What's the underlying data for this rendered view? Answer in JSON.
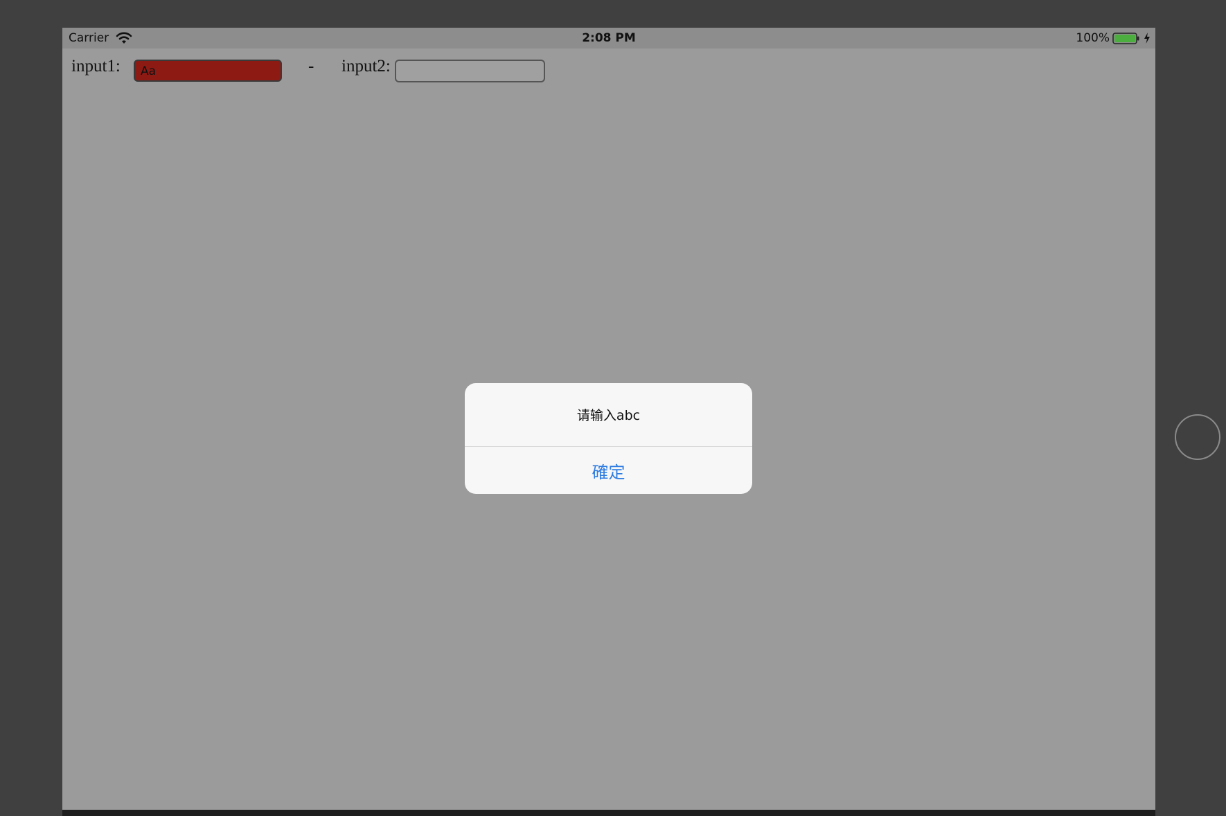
{
  "status_bar": {
    "carrier": "Carrier",
    "time": "2:08 PM",
    "battery_percent": "100%",
    "battery_color": "#4cae3e"
  },
  "form": {
    "input1_label": "input1:",
    "input1_value": "Aa",
    "input1_background": "#8e1a14",
    "separator": "-",
    "input2_label": "input2:",
    "input2_value": ""
  },
  "alert": {
    "message": "请输入abc",
    "confirm_label": "確定",
    "button_color": "#2f7de1"
  }
}
